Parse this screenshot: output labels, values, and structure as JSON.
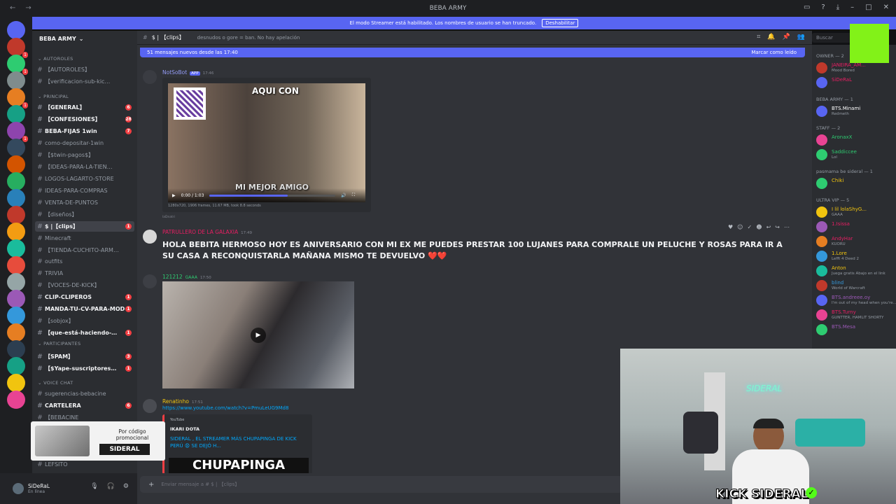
{
  "titlebar": {
    "title": "BEBA ARMY"
  },
  "streamer_banner": {
    "text": "El modo Streamer está habilitado. Los nombres de usuario se han truncado.",
    "button": "Deshabilitar"
  },
  "server": {
    "name": "BEBA ARMY"
  },
  "channel_header": {
    "name": "$ | 【clips】",
    "topic": "desnudos o gore = ban. No hay apelación"
  },
  "search": {
    "placeholder": "Buscar"
  },
  "new_messages": {
    "text": "51 mensajes nuevos desde las 17:40",
    "mark_read": "Marcar como leído"
  },
  "categories": [
    {
      "label": "AUTOROLES"
    },
    {
      "label": "PRINCIPAL"
    },
    {
      "label": "PARTICIPANTES"
    },
    {
      "label": "VOICE CHAT"
    }
  ],
  "channels": [
    {
      "name": "【AUTOROLES】",
      "badge": ""
    },
    {
      "name": "【verificacion-sub-kic…",
      "badge": ""
    },
    {
      "name": "【GENERAL】",
      "badge": "6"
    },
    {
      "name": "【CONFESIONES】",
      "badge": "28"
    },
    {
      "name": "BEBA-FIJAS 1win",
      "badge": "7"
    },
    {
      "name": "como-depositar-1win",
      "badge": ""
    },
    {
      "name": "【$twin-pagos$】",
      "badge": ""
    },
    {
      "name": "【IDEAS-PARA-LA-TIEN…",
      "badge": ""
    },
    {
      "name": "LOGOS-LAGARTO-STORE",
      "badge": ""
    },
    {
      "name": "IDEAS-PARA-COMPRAS",
      "badge": ""
    },
    {
      "name": "VENTA-DE-PUNTOS",
      "badge": ""
    },
    {
      "name": "【diseños】",
      "badge": ""
    },
    {
      "name": "$ |【clips】",
      "badge": "1"
    },
    {
      "name": "Minecraft",
      "badge": ""
    },
    {
      "name": "【TIENDA-CUCHITO-ARM…",
      "badge": ""
    },
    {
      "name": "outfits",
      "badge": ""
    },
    {
      "name": "TRIVIA",
      "badge": ""
    },
    {
      "name": "【VOCES-DE-KICK】",
      "badge": ""
    },
    {
      "name": "CLIP-CLIPEROS",
      "badge": "1"
    },
    {
      "name": "MANDA-TU-CV-PARA-MOD",
      "badge": "1"
    },
    {
      "name": "【sobjox】",
      "badge": ""
    },
    {
      "name": "【que-está-haciendo-…",
      "badge": "1"
    },
    {
      "name": "【SPAM】",
      "badge": "3"
    },
    {
      "name": "【$Yape-suscriptores…",
      "badge": "1"
    },
    {
      "name": "sugerencias-bebacine",
      "badge": ""
    },
    {
      "name": "CARTELERA",
      "badge": "6"
    },
    {
      "name": "【BEBACINE",
      "badge": ""
    },
    {
      "name": "LEFSITO",
      "badge": ""
    }
  ],
  "user": {
    "name": "SiDeRaL",
    "status": "En línea"
  },
  "messages": [
    {
      "author": "NotSoBot",
      "tag": "APP",
      "time": "17:46",
      "video_caption_top": "AQUI CON",
      "video_caption_bottom": "MI MEJOR AMIGO",
      "video_time": "0:00 / 1:03",
      "meta": "1280x720, 1906 frames, 11.67 MB, took 8.8 seconds",
      "footer": "laDnatri"
    },
    {
      "author": "PATRULLERO DE LA GALAXIA",
      "time": "17:49",
      "text": "HOLA BEBITA HERMOSO HOY ES ANIVERSARIO CON MI EX  ME PUEDES PRESTAR 100 LUJANES PARA COMPRALE UN PELUCHE Y ROSAS PARA IR A SU CASA A RECONQUISTARLA MAÑANA MISMO TE DEVUELVO ❤️❤️"
    },
    {
      "author": "121212",
      "badge": "GAAA",
      "time": "17:50"
    },
    {
      "author": "Renatinho",
      "time": "17:51",
      "link": "https://www.youtube.com/watch?v=PmuLeUG9Md8",
      "embed_site": "YouTube",
      "embed_author": "IKARI DOTA",
      "embed_title": "SIDERAL , EL STREAMER MÁS CHUPAPINGA DE KICK PERÚ 😧 SE DEJÓ H...",
      "thumb_text": "CHUPAPINGA"
    }
  ],
  "composer": {
    "placeholder": "Enviar mensaje a # $ | 【clips】"
  },
  "members": {
    "groups": [
      {
        "label": "OWNER — 2",
        "items": [
          {
            "name": "JANEIRA_AM...",
            "status": "Mood Bored",
            "color": "#e91e63"
          },
          {
            "name": "SiDeRaL",
            "status": "",
            "color": "#e91e63"
          }
        ]
      },
      {
        "label": "BEBA ARMY — 1",
        "items": [
          {
            "name": "BTS.Minami",
            "status": "Redmeth",
            "color": "#ffffff"
          }
        ]
      },
      {
        "label": "STAFF — 2",
        "items": [
          {
            "name": "AronaxX",
            "status": "",
            "color": "#2ecc71"
          },
          {
            "name": "Saddiccee",
            "status": "Lol",
            "color": "#2ecc71"
          }
        ]
      },
      {
        "label": "pasmama be sideral — 1",
        "items": [
          {
            "name": "Chiki",
            "status": "",
            "color": "#f1c40f"
          }
        ]
      },
      {
        "label": "ULTRA VIP — 5",
        "items": [
          {
            "name": "I lil lolaShyG...",
            "status": "GAAA",
            "color": "#f1c40f"
          },
          {
            "name": "1.Isissa",
            "status": "",
            "color": "#e91e63"
          },
          {
            "name": "AndyHar",
            "status": "KUORU",
            "color": "#e91e63"
          },
          {
            "name": "1.Lore",
            "status": "Lefft 4 Deed 2",
            "color": "#f1c40f"
          },
          {
            "name": "Anton",
            "status": "Juega gratis Abajo en el link",
            "color": "#f1c40f"
          },
          {
            "name": "blind",
            "status": "World of Warcraft",
            "color": "#3498db"
          },
          {
            "name": "BTS.andreee.oy",
            "status": "I'm out of my head when you're...",
            "color": "#9b59b6"
          },
          {
            "name": "BTS.Turny",
            "status": "GUNTTER, HAMLIT SHORTY",
            "color": "#e91e63"
          },
          {
            "name": "BTS.Mesa",
            "status": "",
            "color": "#9b59b6"
          }
        ]
      }
    ]
  },
  "promo": {
    "line1": "Por código",
    "line2": "promocional",
    "code": "SIDERAL"
  },
  "webcam": {
    "sign": "SIDERAL",
    "kick_label": "KICK SIDERAL"
  }
}
